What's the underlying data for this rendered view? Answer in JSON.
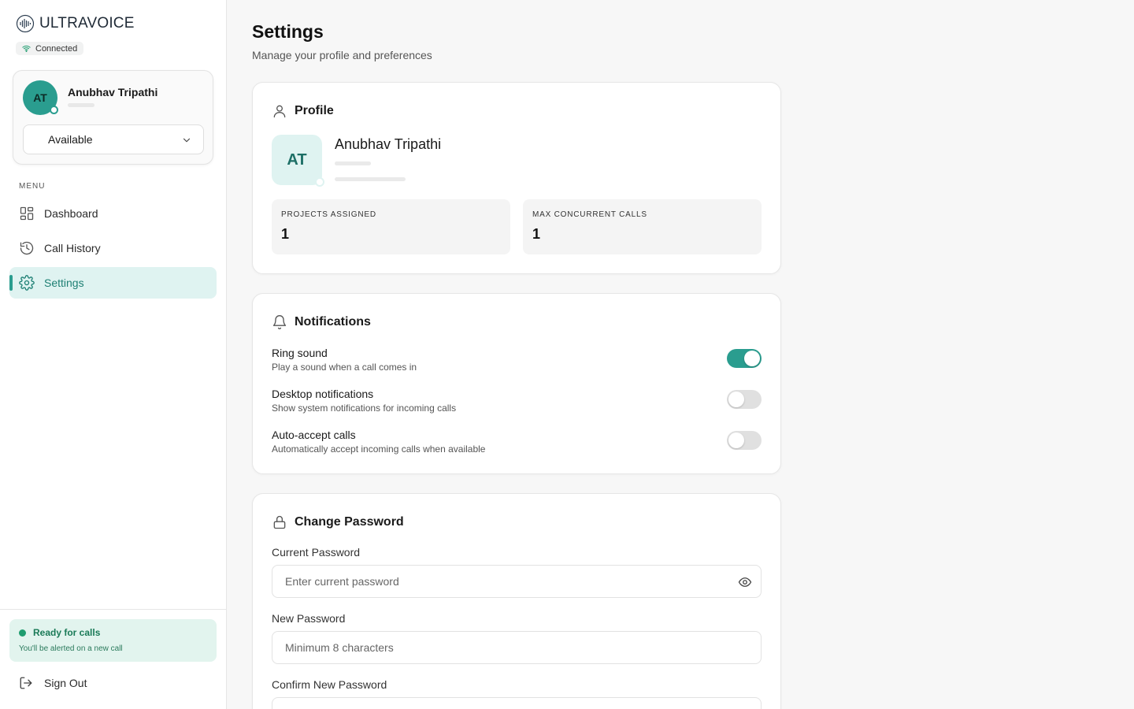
{
  "brand": {
    "name": "ULTRAVOICE"
  },
  "connection": {
    "status": "Connected"
  },
  "user": {
    "initials": "AT",
    "name": "Anubhav Tripathi",
    "status": "Available"
  },
  "menu": {
    "label": "MENU",
    "items": [
      {
        "label": "Dashboard",
        "icon": "dashboard-icon"
      },
      {
        "label": "Call History",
        "icon": "history-icon"
      },
      {
        "label": "Settings",
        "icon": "gear-icon",
        "active": true
      }
    ]
  },
  "ready": {
    "title": "Ready for calls",
    "subtitle": "You'll be alerted on a new call"
  },
  "signout": {
    "label": "Sign Out"
  },
  "page": {
    "title": "Settings",
    "subtitle": "Manage your profile and preferences"
  },
  "profile": {
    "heading": "Profile",
    "initials": "AT",
    "name": "Anubhav Tripathi",
    "stats": [
      {
        "label": "PROJECTS ASSIGNED",
        "value": "1"
      },
      {
        "label": "MAX CONCURRENT CALLS",
        "value": "1"
      }
    ]
  },
  "notifications": {
    "heading": "Notifications",
    "items": [
      {
        "title": "Ring sound",
        "description": "Play a sound when a call comes in",
        "enabled": true
      },
      {
        "title": "Desktop notifications",
        "description": "Show system notifications for incoming calls",
        "enabled": false
      },
      {
        "title": "Auto-accept calls",
        "description": "Automatically accept incoming calls when available",
        "enabled": false
      }
    ]
  },
  "password": {
    "heading": "Change Password",
    "current": {
      "label": "Current Password",
      "placeholder": "Enter current password",
      "value": ""
    },
    "new": {
      "label": "New Password",
      "placeholder": "Minimum 8 characters",
      "value": ""
    },
    "confirm": {
      "label": "Confirm New Password",
      "placeholder": "",
      "value": ""
    }
  },
  "colors": {
    "accent": "#2a9d8f",
    "accent_light": "#dff3f1",
    "ready_bg": "#e2f4ee"
  }
}
